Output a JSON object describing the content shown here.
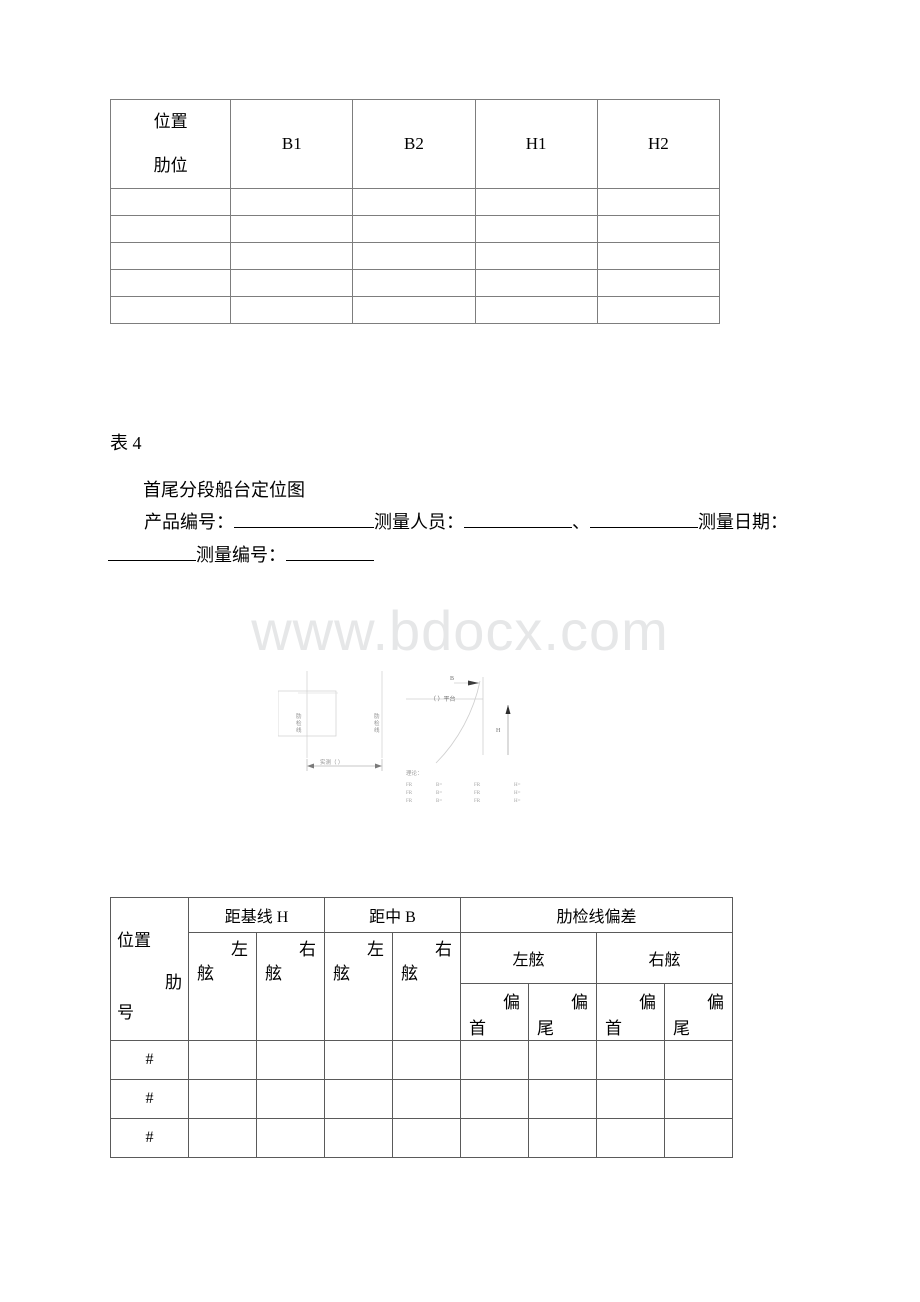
{
  "document": {
    "watermark": "www.bdocx.com",
    "section_label": "表 4",
    "section_title": "首尾分段船台定位图"
  },
  "table_one": {
    "header": {
      "corner_top": "位置",
      "corner_bottom": "肋位",
      "columns": [
        "B1",
        "B2",
        "H1",
        "H2"
      ]
    },
    "rows": [
      [
        "",
        "",
        "",
        "",
        ""
      ],
      [
        "",
        "",
        "",
        "",
        ""
      ],
      [
        "",
        "",
        "",
        "",
        ""
      ],
      [
        "",
        "",
        "",
        "",
        ""
      ],
      [
        "",
        "",
        "",
        "",
        ""
      ]
    ]
  },
  "form": {
    "product_no_label": "产品编号：",
    "surveyor_label": "测量人员：",
    "separator": "、",
    "survey_date_label": "测量日期",
    "colon": "：",
    "survey_no_label": "测量编号：",
    "product_no_value": "",
    "surveyor_value_1": "",
    "surveyor_value_2": "",
    "survey_date_value": "",
    "survey_no_value": ""
  },
  "diagram": {
    "label_rib_line_left": "肋检线",
    "label_rib_line_right": "肋检线",
    "label_measured": "实测（    ）",
    "label_b": "B",
    "label_platform": "（    ）平台",
    "label_h": "H",
    "label_theory": "理论：",
    "theory_rows": [
      {
        "fr_left": "FR",
        "b": "B=",
        "fr_right": "FR",
        "h": "H="
      },
      {
        "fr_left": "FR",
        "b": "B=",
        "fr_right": "FR",
        "h": "H="
      },
      {
        "fr_left": "FR",
        "b": "B=",
        "fr_right": "FR",
        "h": "H="
      }
    ]
  },
  "table_two": {
    "header": {
      "corner_top": "位置",
      "corner_mid": "肋",
      "corner_bottom": "号",
      "group_h": "距基线 H",
      "group_b": "距中 B",
      "group_dev": "肋检线偏差",
      "side_port": "左舷",
      "side_starboard": "右舷",
      "sub_left_top": "左",
      "sub_left_bottom": "舷",
      "sub_right_top": "右",
      "sub_right_bottom": "舷",
      "sub_bow_top": "偏",
      "sub_bow_bottom": "首",
      "sub_stern_top": "偏",
      "sub_stern_bottom": "尾"
    },
    "rows": [
      {
        "rib": "#",
        "cells": [
          "",
          "",
          "",
          "",
          "",
          "",
          "",
          ""
        ]
      },
      {
        "rib": "#",
        "cells": [
          "",
          "",
          "",
          "",
          "",
          "",
          "",
          ""
        ]
      },
      {
        "rib": "#",
        "cells": [
          "",
          "",
          "",
          "",
          "",
          "",
          "",
          ""
        ]
      }
    ]
  }
}
